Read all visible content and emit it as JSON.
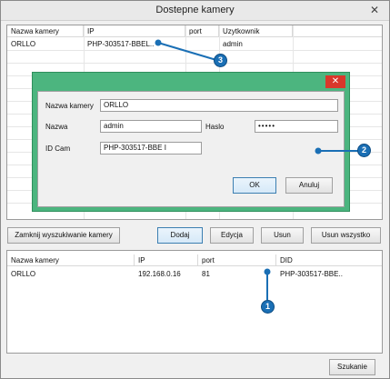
{
  "window": {
    "title": "Dostepne kamery",
    "close_glyph": "✕"
  },
  "top_grid": {
    "headers": [
      "Nazwa kamery",
      "IP",
      "port",
      "Uzytkownik"
    ],
    "rows": [
      {
        "name": "ORLLO",
        "ip": "PHP-303517-BBEL..",
        "port": "",
        "user": "admin"
      }
    ]
  },
  "dialog": {
    "close_glyph": "✕",
    "accent_color": "#4cb57f",
    "fields": {
      "camera_name_label": "Nazwa kamery",
      "camera_name_value": "ORLLO",
      "name_label": "Nazwa",
      "name_value": "admin",
      "password_label": "Haslo",
      "password_value": "•••••",
      "id_cam_label": "ID Cam",
      "id_cam_value": "PHP-303517-BBE   I"
    },
    "ok_label": "OK",
    "cancel_label": "Anuluj"
  },
  "toolbar": {
    "close_search_label": "Zamknij wyszukiwanie kamery",
    "add_label": "Dodaj",
    "edit_label": "Edycja",
    "delete_label": "Usun",
    "delete_all_label": "Usun wszystko"
  },
  "bottom_grid": {
    "headers": [
      "Nazwa kamery",
      "IP",
      "port",
      "DID"
    ],
    "rows": [
      {
        "name": "ORLLO",
        "ip": "192.168.0.16",
        "port": "81",
        "did": "PHP-303517-BBE.."
      }
    ]
  },
  "search_label": "Szukanie",
  "callouts": [
    "1",
    "2",
    "3"
  ],
  "callout_color": "#1a6fb5"
}
